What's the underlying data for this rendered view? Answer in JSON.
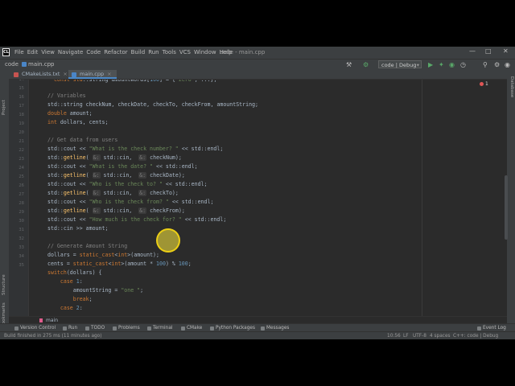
{
  "window": {
    "app_icon_text": "CL",
    "title": "code - main.cpp",
    "menu": [
      "File",
      "Edit",
      "View",
      "Navigate",
      "Code",
      "Refactor",
      "Build",
      "Run",
      "Tools",
      "VCS",
      "Window",
      "Help"
    ]
  },
  "navbar": {
    "project": "code",
    "file": "main.cpp",
    "run_config": "code | Debug"
  },
  "tabs": [
    {
      "label": "CMakeLists.txt",
      "icon_color": "#c75450"
    },
    {
      "label": "main.cpp",
      "icon_color": "#4a86c8",
      "active": true
    }
  ],
  "left_strip": [
    "Project",
    "Structure",
    "Bookmarks"
  ],
  "right_strip": [
    "Database"
  ],
  "problems_count": "1",
  "gutter_lines": [
    "14",
    "15",
    "16",
    "17",
    "18",
    "19",
    "20",
    "21",
    "22",
    "23",
    "24",
    "25",
    "26",
    "27",
    "28",
    "29",
    "30",
    "31",
    "32",
    "33",
    "34",
    "35"
  ],
  "breadcrumb": "main",
  "tool_windows": [
    "Version Control",
    "Run",
    "TODO",
    "Problems",
    "Terminal",
    "CMake",
    "Python Packages",
    "Messages"
  ],
  "event_log": "Event Log",
  "status": {
    "message": "Build finished in 275 ms (11 minutes ago)",
    "position": "10:56",
    "line_sep": "LF",
    "encoding": "UTF-8",
    "indent": "4 spaces",
    "context": "C++: code | Debug"
  },
  "colors": {
    "accent": "#4a88c7",
    "editor_bg": "#2b2b2b",
    "chrome_bg": "#3c3f41",
    "highlight": "#f0d214"
  }
}
